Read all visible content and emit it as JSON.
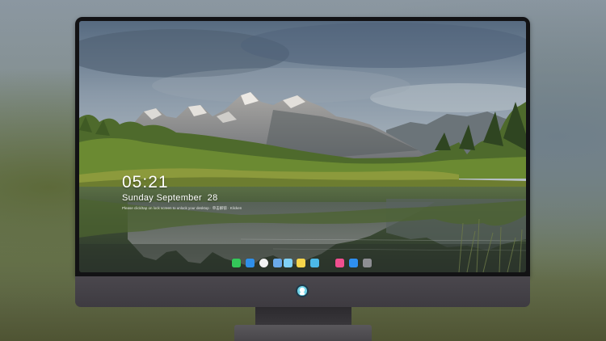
{
  "lockscreen": {
    "time": "05:21",
    "date": "Sunday September  28",
    "hint": "Please click/tap on lock screen to unlock your desktop · 单击解锁 · Klicken"
  },
  "dock": {
    "apps": [
      {
        "name": "messages-icon",
        "color": "#34c759"
      },
      {
        "name": "weather-icon",
        "color": "#2f8fe8"
      },
      {
        "name": "clock-icon",
        "color": "#f2f2f2"
      },
      {
        "name": "finder-icon",
        "color": "#6aa9e9"
      },
      {
        "name": "photos-icon",
        "color": "#7fd0f5"
      },
      {
        "name": "notes-icon",
        "color": "#f6d54a"
      },
      {
        "name": "maps-icon",
        "color": "#4cb9e8"
      },
      {
        "name": "music-icon",
        "color": "#f04f8f"
      },
      {
        "name": "appstore-icon",
        "color": "#2e8ff0"
      },
      {
        "name": "camera-icon",
        "color": "#8e8e93"
      }
    ]
  },
  "colors": {
    "bezel": "#121214",
    "chin": "#434046",
    "sky_top": "#5d6f82",
    "water": "#2e3a2a"
  }
}
